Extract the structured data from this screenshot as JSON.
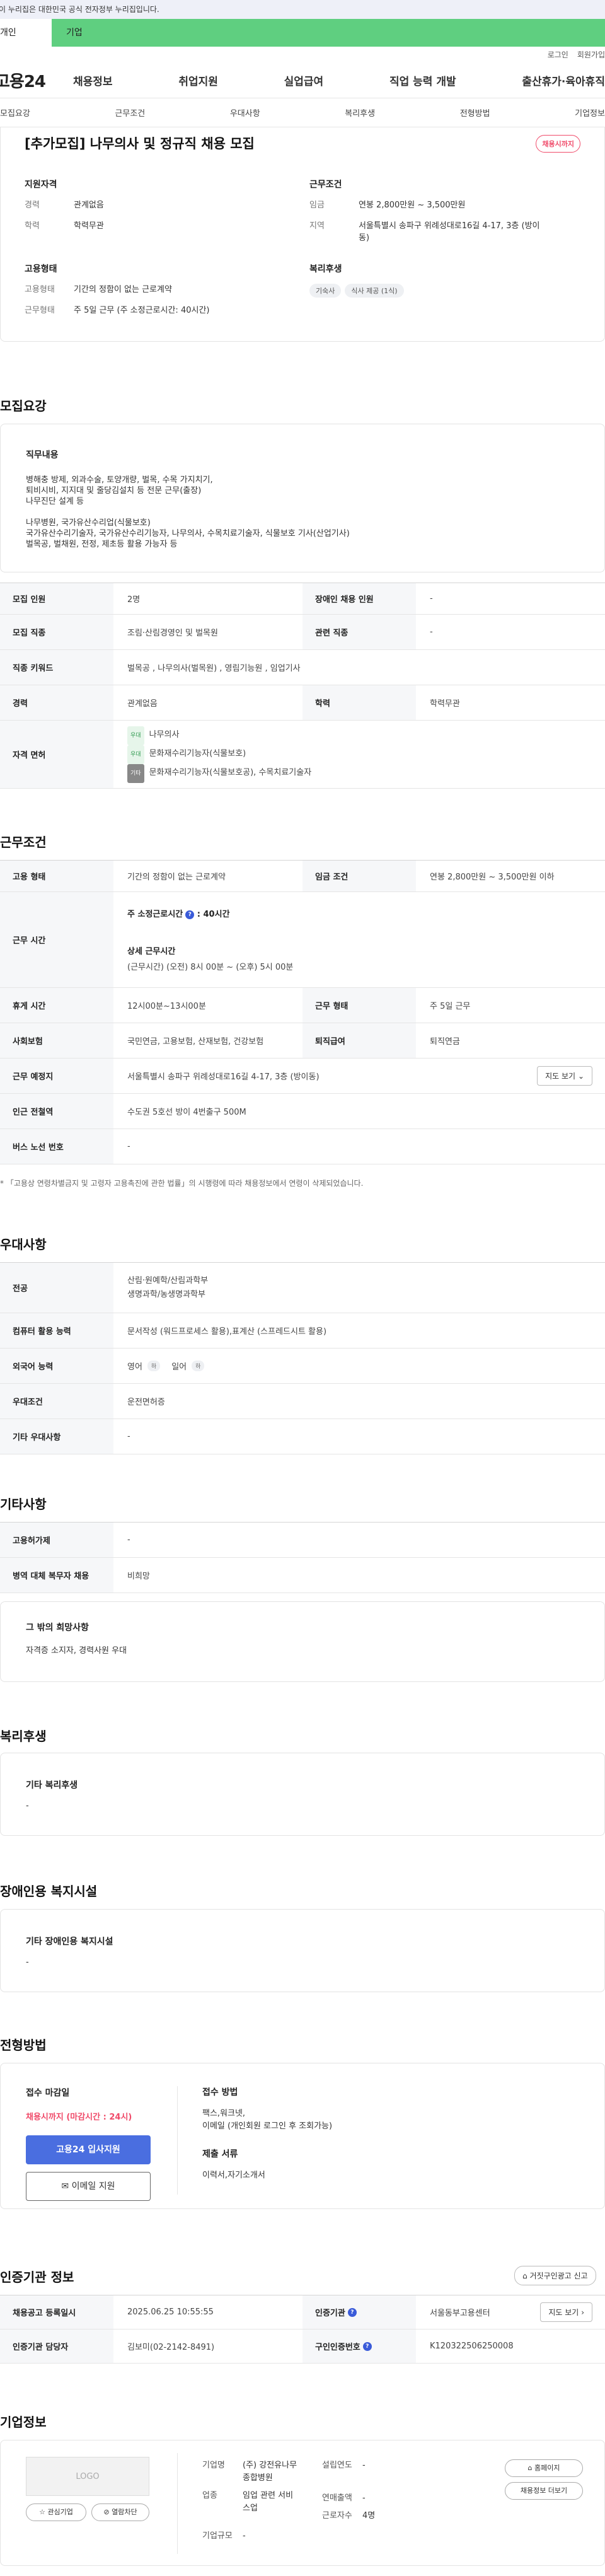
{
  "notice": "이 누리집은 대한민국 공식 전자정부 누리집입니다.",
  "seg": {
    "a": "개인",
    "b": "기업"
  },
  "util": {
    "login": "로그인",
    "join": "회원가입"
  },
  "logo": "고용24",
  "gnb": [
    "채용정보",
    "취업지원",
    "실업급여",
    "직업 능력 개발",
    "출산휴가·육아휴직"
  ],
  "tabs": [
    "모집요강",
    "근무조건",
    "우대사항",
    "복리후생",
    "전형방법",
    "기업정보"
  ],
  "summary": {
    "title": "[추가모집] 나무의사 및 정규직 채용 모집",
    "badge": "채용시까지",
    "qual_h": "지원자격",
    "career_k": "경력",
    "career_v": "관계없음",
    "edu_k": "학력",
    "edu_v": "학력무관",
    "cond_h": "근무조건",
    "wage_k": "임금",
    "wage_v": "연봉 2,800만원 ~ 3,500만원",
    "area_k": "지역",
    "area_v": "서울특별시 송파구 위례성대로16길 4-17, 3층 (방이동)",
    "type_h": "고용형태",
    "emp_k": "고용형태",
    "emp_v": "기간의 정함이 없는 근로계약",
    "work_k": "근무형태",
    "work_v": "주 5일 근무 (주 소정근로시간: 40시간)",
    "welfare_h": "복리후생",
    "chip1": "기숙사",
    "chip2": "식사 제공 (1식)"
  },
  "recruit": {
    "title": "모집요강",
    "duty_h": "직무내용",
    "duty_lines": [
      "병해충 방제, 외과수술, 토양개량, 벌목, 수목 가지치기,",
      "퇴비시비, 지지대 및 줄당김설치 등 전문 근무(출장)",
      "나무진단 설계 등",
      "",
      "나무병원,  국가유산수리업(식물보호)",
      "국가유산수리기술자, 국가유산수리기능자, 나무의사, 수목치료기술자, 식물보호 기사(산업기사)",
      "벌목공, 벌채원, 전정, 제초등 활용 가능자 등"
    ],
    "rows": {
      "count_k": "모집 인원",
      "count_v": "2명",
      "disabled_k": "장애인 채용 인원",
      "disabled_v": "-",
      "job_k": "모집 직종",
      "job_v": "조림·산림경영인 및 벌목원",
      "rel_k": "관련 직종",
      "rel_v": "-",
      "kw_k": "직종 키워드",
      "kw_v": "벌목공 , 나무의사(벌목원) , 영림기능원 , 임업기사",
      "car_k": "경력",
      "car_v": "관계없음",
      "edu_k": "학력",
      "edu_v": "학력무관",
      "lic_k": "자격 면허",
      "lic1_tag": "우대",
      "lic1": "나무의사",
      "lic2_tag": "우대",
      "lic2": "문화재수리기능자(식물보호)",
      "lic3_tag": "기타",
      "lic3": "문화재수리기능자(식물보호공), 수목치료기술자"
    }
  },
  "cond": {
    "title": "근무조건",
    "emp_k": "고용 형태",
    "emp_v": "기간의 정함이 없는 근로계약",
    "wage_k": "임금 조건",
    "wage_v": "연봉 2,800만원 ~ 3,500만원 이하",
    "time_k": "근무 시간",
    "time_h1": "주 소정근로시간",
    "time_v1": "40시간",
    "time_h2": "상세 근무시간",
    "time_v2": "(근무시간) (오전) 8시 00분 ~ (오후) 5시 00분",
    "rest_k": "휴게 시간",
    "rest_v": "12시00분~13시00분",
    "form_k": "근무 형태",
    "form_v": "주 5일 근무",
    "ins_k": "사회보험",
    "ins_v": "국민연금, 고용보험, 산재보험, 건강보험",
    "ret_k": "퇴직급여",
    "ret_v": "퇴직연금",
    "place_k": "근무 예정지",
    "place_v": "서울특별시 송파구 위례성대로16길 4-17, 3층 (방이동)",
    "map_btn": "지도 보기",
    "sub_k": "인근 전철역",
    "sub_v": "수도권 5호선 방이 4번출구 500M",
    "bus_k": "버스 노선 번호",
    "bus_v": "-",
    "note": "* 「고용상 연령차별금지 및 고령자 고용촉진에 관한 법률」의 시행령에 따라 채용정보에서 연령이 삭제되었습니다."
  },
  "pref": {
    "title": "우대사항",
    "major_k": "전공",
    "major_v1": "산림·원예학/산림과학부",
    "major_v2": "생명과학/농생명과학부",
    "pc_k": "컴퓨터 활용 능력",
    "pc_v": "문서작성 (워드프로세스 활용),표계산 (스프레드시트 활용)",
    "lang_k": "외국어 능력",
    "lang1": "영어",
    "lang2": "일어",
    "lang_tag": "하",
    "prefc_k": "우대조건",
    "prefc_v": "운전면허증",
    "etc_k": "기타 우대사항",
    "etc_v": "-"
  },
  "other": {
    "title": "기타사항",
    "perm_k": "고용허가제",
    "perm_v": "-",
    "mil_k": "병역 대체 복무자 채용",
    "mil_v": "비희망",
    "box_h": "그 밖의 희망사항",
    "box_v": "자격증 소지자, 경력사원 우대"
  },
  "welfare": {
    "title": "복리후생",
    "box_h": "기타 복리후생",
    "box_v": "-"
  },
  "disab": {
    "title": "장애인용 복지시설",
    "box_h": "기타 장애인용 복지시설",
    "box_v": "-"
  },
  "process": {
    "title": "전형방법",
    "deadline_h": "접수 마감일",
    "deadline_v": "채용시까지 (마감시간 : 24시)",
    "apply_btn": "고용24 입사지원",
    "email_btn": "이메일 지원",
    "method_h": "접수 방법",
    "method_v1": "팩스,워크넷,",
    "method_v2": "이메일 (개인회원 로그인 후 조회가능)",
    "doc_h": "제출 서류",
    "doc_v": "이력서,자기소개서"
  },
  "cert": {
    "title": "인증기관 정보",
    "report_btn": "거짓구인광고 신고",
    "reg_k": "채용공고 등록일시",
    "reg_v": "2025.06.25 10:55:55",
    "org_k": "인증기관",
    "org_v": "서울동부고용센터",
    "map_btn": "지도 보기",
    "mgr_k": "인증기관 담당자",
    "mgr_v": "김보미(02-2142-8491)",
    "num_k": "구인인증번호",
    "num_v": "K120322506250008"
  },
  "company": {
    "title": "기업정보",
    "logo": "LOGO",
    "fav_btn": "관심기업",
    "block_btn": "열람차단",
    "name_k": "기업명",
    "name_v": "(주) 강전유나무종합병원",
    "est_k": "설립연도",
    "est_v": "-",
    "ind_k": "업종",
    "ind_v": "임업 관련 서비스업",
    "sales_k": "연매출액",
    "sales_v": "-",
    "emp_k": "근로자수",
    "emp_v": "4명",
    "size_k": "기업규모",
    "size_v": "-",
    "home_btn": "홈페이지",
    "list_btn": "채용정보 더보기"
  },
  "colors": {
    "accent": "#4a6ee0",
    "red": "#f04b6a",
    "green": "#5fcf80"
  }
}
